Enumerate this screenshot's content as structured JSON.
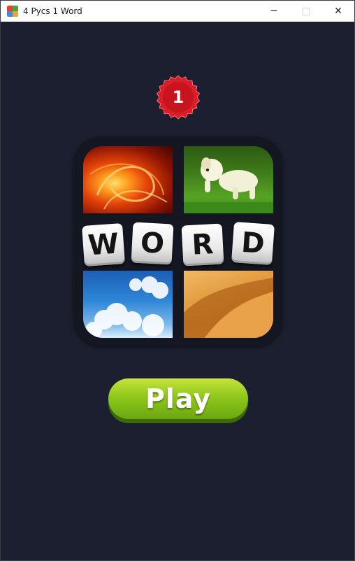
{
  "window": {
    "title": "4 Pycs 1 Word",
    "controls": {
      "minimize": "─",
      "maximize": "□",
      "close": "✕"
    }
  },
  "level_badge": {
    "value": "1",
    "color": "#d91e2a"
  },
  "logo": {
    "letters": [
      "W",
      "O",
      "R",
      "D"
    ],
    "tiles": [
      "fire-image",
      "dog-image",
      "sky-image",
      "desert-image"
    ]
  },
  "play_button": {
    "label": "Play",
    "color": "#8fc81c"
  },
  "colors": {
    "background": "#1c1f2f"
  }
}
